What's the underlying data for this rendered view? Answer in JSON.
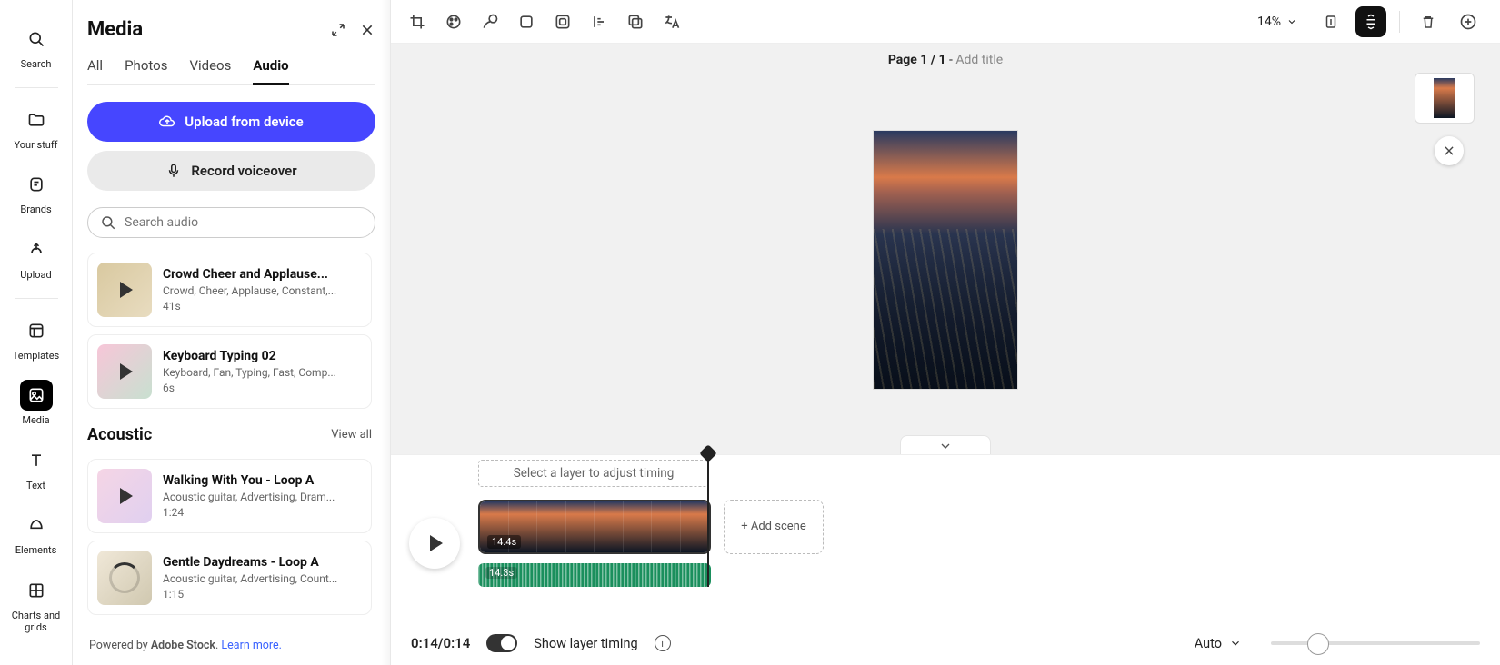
{
  "left_rail": {
    "items": [
      {
        "label": "Search"
      },
      {
        "label": "Your stuff"
      },
      {
        "label": "Brands"
      },
      {
        "label": "Upload"
      },
      {
        "label": "Templates"
      },
      {
        "label": "Media"
      },
      {
        "label": "Text"
      },
      {
        "label": "Elements"
      },
      {
        "label": "Charts and grids"
      }
    ]
  },
  "media_panel": {
    "title": "Media",
    "tabs": {
      "all": "All",
      "photos": "Photos",
      "videos": "Videos",
      "audio": "Audio"
    },
    "upload_label": "Upload from device",
    "record_label": "Record voiceover",
    "search_placeholder": "Search audio",
    "top_items": [
      {
        "title": "Crowd Cheer and Applause...",
        "tags": "Crowd, Cheer, Applause, Constant,...",
        "dur": "41s"
      },
      {
        "title": "Keyboard Typing 02",
        "tags": "Keyboard, Fan, Typing, Fast, Comp...",
        "dur": "6s"
      }
    ],
    "section_title": "Acoustic",
    "view_all": "View all",
    "acoustic_items": [
      {
        "title": "Walking With You - Loop A",
        "tags": "Acoustic guitar, Advertising, Dram...",
        "dur": "1:24"
      },
      {
        "title": "Gentle Daydreams - Loop A",
        "tags": "Acoustic guitar, Advertising, Count...",
        "dur": "1:15"
      }
    ],
    "footer_prefix": "Powered by ",
    "footer_brand": "Adobe Stock",
    "footer_dot": ". ",
    "footer_link": "Learn more."
  },
  "toolbar": {
    "zoom": "14%"
  },
  "canvas": {
    "page_prefix": "Page ",
    "page_cur": "1",
    "page_sep": " / ",
    "page_total": "1",
    "page_dash": " - ",
    "add_title": "Add title"
  },
  "timeline": {
    "hint": "Select a layer to adjust timing",
    "video_dur": "14.4s",
    "audio_dur": "14.3s",
    "add_scene": "+ Add scene",
    "readout": "0:14/0:14",
    "layer_toggle_label": "Show layer timing",
    "auto": "Auto"
  }
}
